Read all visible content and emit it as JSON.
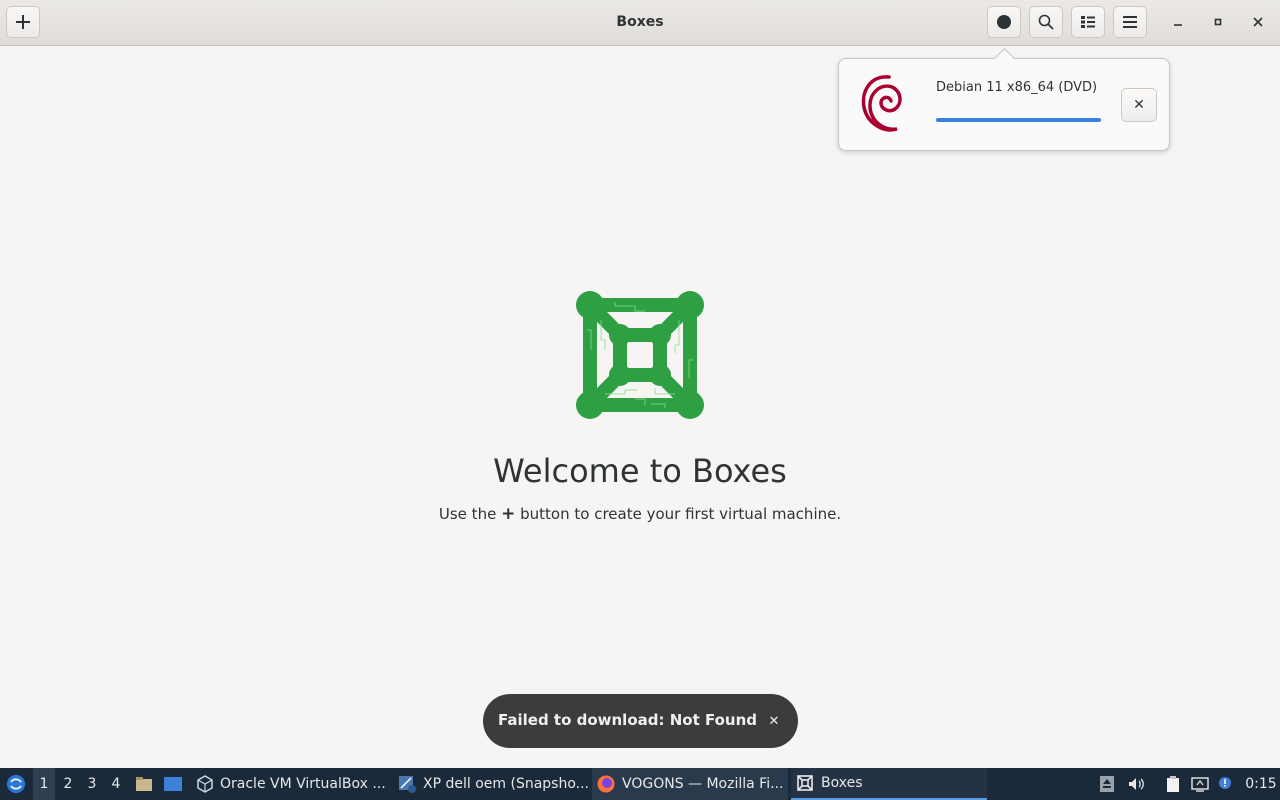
{
  "window": {
    "title": "Boxes"
  },
  "header": {
    "new_icon": "plus-icon",
    "selection_icon": "record-icon",
    "search_icon": "search-icon",
    "view_icon": "list-view-icon",
    "menu_icon": "hamburger-menu-icon"
  },
  "download_popover": {
    "name": "Debian 11 x86_64 (DVD)",
    "progress": 1.0,
    "cancel_label": "✕"
  },
  "welcome": {
    "title": "Welcome to Boxes",
    "sub_before": "Use the",
    "sub_plus": "+",
    "sub_after": "button to create your first virtual machine."
  },
  "toast": {
    "message": "Failed to download: Not Found",
    "close_label": "✕"
  },
  "taskbar": {
    "workspaces": [
      "1",
      "2",
      "3",
      "4"
    ],
    "active_workspace": "1",
    "tasks": [
      {
        "label": "Oracle VM VirtualBox ..."
      },
      {
        "label": "XP dell oem (Snapsho..."
      },
      {
        "label": "VOGONS — Mozilla Fi..."
      },
      {
        "label": "Boxes"
      }
    ],
    "clock": "0:15"
  },
  "colors": {
    "accent": "#3584e4",
    "logo_green": "#2ea043",
    "debian_red": "#a80030",
    "taskbar_bg": "#1b2a3a"
  }
}
